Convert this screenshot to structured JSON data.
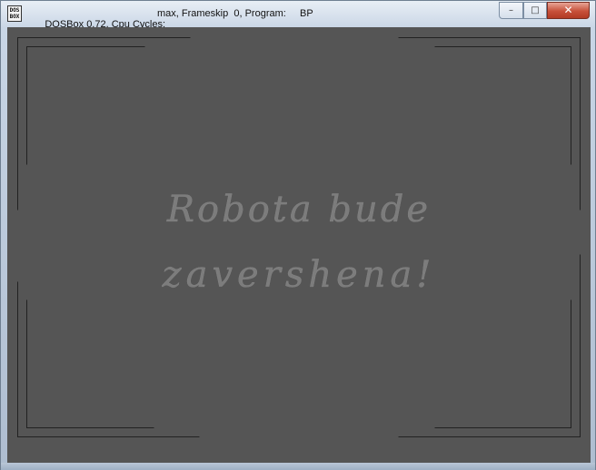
{
  "window": {
    "title_app": "DOSBox 0.72, Cpu Cycles:",
    "title_cycles": "max, Frameskip  0, Program:",
    "title_program": "BP",
    "icon_text_top": "DOS",
    "icon_text_bottom": "BOX",
    "controls": {
      "minimize": "–",
      "maximize": "□",
      "close": "✕"
    }
  },
  "screen": {
    "message_line1": "Robota bude",
    "message_line2": "zavershena!",
    "background_color": "#555555",
    "frame_color": "#222222"
  }
}
